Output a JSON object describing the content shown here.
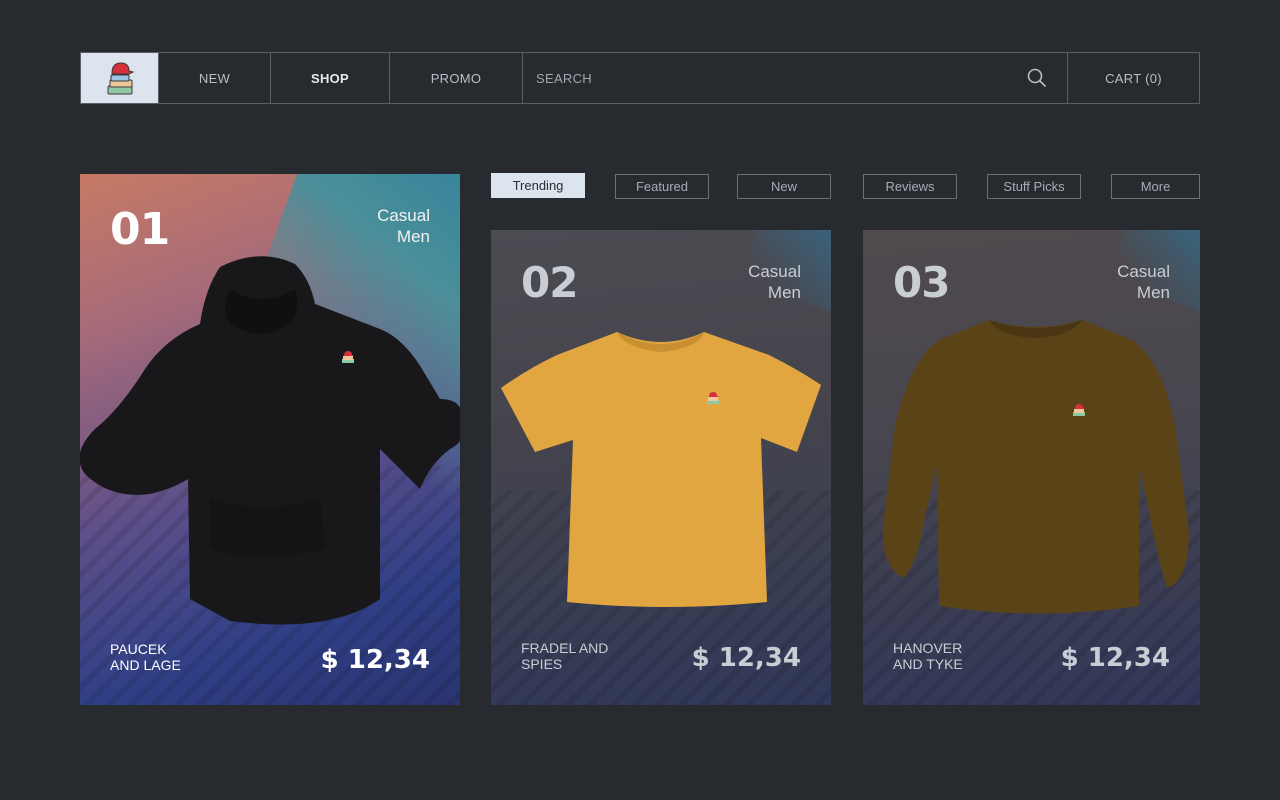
{
  "nav": {
    "logo_icon": "clothing-stack-logo-icon",
    "items": [
      {
        "label": "NEW"
      },
      {
        "label": "SHOP"
      },
      {
        "label": "PROMO"
      }
    ],
    "search_label": "SEARCH",
    "search_icon": "search-icon",
    "cart_label": "CART (0)"
  },
  "tabs": [
    {
      "label": "Trending",
      "active": true
    },
    {
      "label": "Featured"
    },
    {
      "label": "New"
    },
    {
      "label": "Reviews"
    },
    {
      "label": "Stuff Picks"
    },
    {
      "label": "More"
    }
  ],
  "products": [
    {
      "number": "01",
      "category_line1": "Casual",
      "category_line2": "Men",
      "brand_line1": "PAUCEK",
      "brand_line2": "AND LAGE",
      "price": "$ 12,34",
      "item": "hoodie-icon",
      "color": "#1c1c1f"
    },
    {
      "number": "02",
      "category_line1": "Casual",
      "category_line2": "Men",
      "brand_line1": "FRADEL AND",
      "brand_line2": "SPIES",
      "price": "$ 12,34",
      "item": "tshirt-icon",
      "color": "#e1a43f"
    },
    {
      "number": "03",
      "category_line1": "Casual",
      "category_line2": "Men",
      "brand_line1": "HANOVER",
      "brand_line2": "AND TYKE",
      "price": "$ 12,34",
      "item": "sweater-icon",
      "color": "#5b4318"
    }
  ]
}
